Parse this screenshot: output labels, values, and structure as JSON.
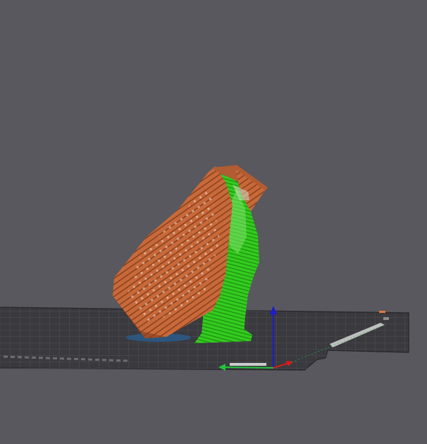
{
  "viewport": {
    "background_color": "#58585e",
    "bed": {
      "surface_color": "#39393e",
      "grid_color": "#50505a",
      "edge_color": "#2a2a2e",
      "bed_label": "",
      "corner_marker_color": "#e8773a"
    },
    "model": {
      "part_color": "#c8693a",
      "part_shadow_color": "#8a4220",
      "support_color": "#32cc1e",
      "support_shadow_color": "#1f8a12",
      "brim_color": "#2a5c8a"
    },
    "axes": {
      "x_color": "#d81c1c",
      "y_color": "#22c43a",
      "z_color": "#1c1cd0"
    }
  }
}
